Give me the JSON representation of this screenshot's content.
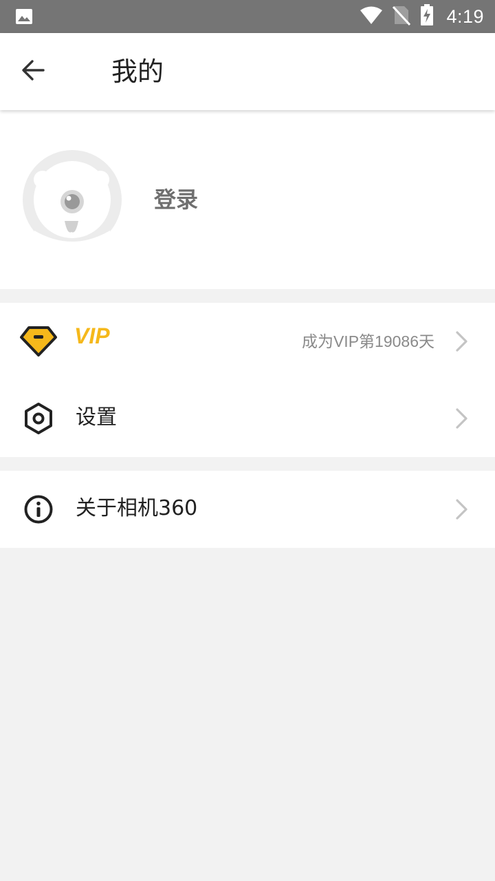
{
  "status_bar": {
    "time": "4:19",
    "icons": [
      "image-icon",
      "wifi-icon",
      "no-sim-icon",
      "battery-charging-icon"
    ]
  },
  "app_bar": {
    "back_icon": "arrow-left-icon",
    "title": "我的"
  },
  "profile": {
    "avatar_icon": "default-avatar-icon",
    "login_label": "登录"
  },
  "menu": {
    "vip": {
      "icon": "diamond-icon",
      "label": "VIP",
      "value": "成为VIP第19086天",
      "color": "#f5b81b"
    },
    "settings": {
      "icon": "hexagon-gear-icon",
      "label": "设置"
    },
    "about": {
      "icon": "info-icon",
      "label": "关于相机360"
    }
  },
  "colors": {
    "accent": "#f5b81b",
    "background": "#f2f2f2",
    "status_bar": "#757575"
  }
}
